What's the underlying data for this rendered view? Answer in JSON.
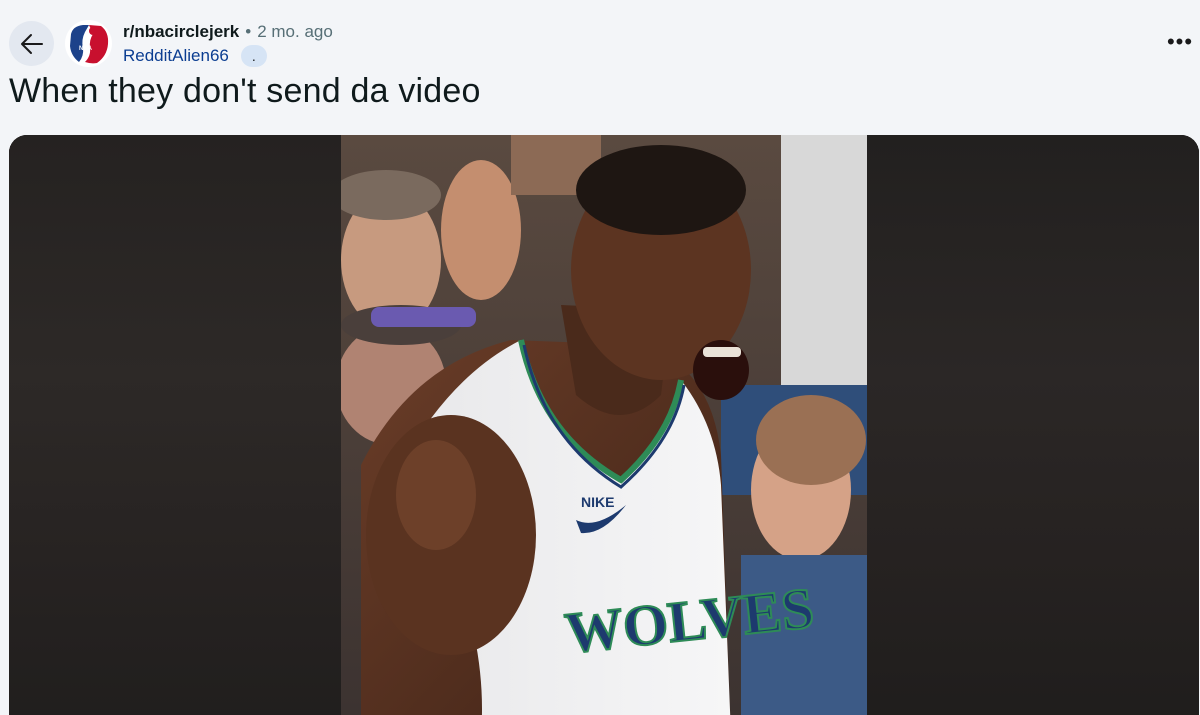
{
  "header": {
    "back_icon": "arrow-left-icon",
    "subreddit": "r/nbacirclejerk",
    "separator": "•",
    "time_ago": "2 mo. ago",
    "author": "RedditAlien66",
    "flair": ".",
    "more_icon": "more-options-icon",
    "more_glyph": "•••"
  },
  "post": {
    "title": "When they don't send da video"
  },
  "media": {
    "jersey_text": "WOLVES"
  }
}
